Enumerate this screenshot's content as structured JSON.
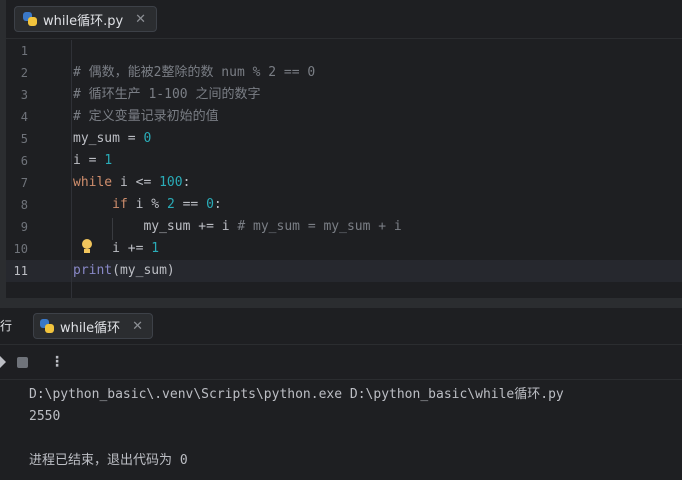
{
  "editor": {
    "tab": {
      "label": "while循环.py",
      "close": "✕",
      "icon": "python-file-icon"
    },
    "line_numbers": [
      "1",
      "2",
      "3",
      "4",
      "5",
      "6",
      "7",
      "8",
      "9",
      "10",
      "11"
    ],
    "current_line": "11",
    "lines": [
      {
        "indent": "",
        "tokens": []
      },
      {
        "indent": "",
        "tokens": [
          {
            "cls": "c",
            "text": "# 偶数，能被2整除的数 num % 2 == 0"
          }
        ]
      },
      {
        "indent": "",
        "tokens": [
          {
            "cls": "c",
            "text": "# 循环生产 1-100 之间的数字"
          }
        ]
      },
      {
        "indent": "",
        "tokens": [
          {
            "cls": "c",
            "text": "# 定义变量记录初始的值"
          }
        ]
      },
      {
        "indent": "",
        "tokens": [
          {
            "cls": "t",
            "text": "my_sum = "
          },
          {
            "cls": "n",
            "text": "0"
          }
        ]
      },
      {
        "indent": "",
        "tokens": [
          {
            "cls": "t",
            "text": "i = "
          },
          {
            "cls": "n",
            "text": "1"
          }
        ]
      },
      {
        "indent": "",
        "tokens": [
          {
            "cls": "k",
            "text": "while"
          },
          {
            "cls": "t",
            "text": " i <= "
          },
          {
            "cls": "n",
            "text": "100"
          },
          {
            "cls": "t",
            "text": ":"
          }
        ]
      },
      {
        "indent": "     ",
        "tokens": [
          {
            "cls": "k",
            "text": "if"
          },
          {
            "cls": "t",
            "text": " i % "
          },
          {
            "cls": "n",
            "text": "2"
          },
          {
            "cls": "t",
            "text": " == "
          },
          {
            "cls": "n",
            "text": "0"
          },
          {
            "cls": "t",
            "text": ":"
          }
        ]
      },
      {
        "indent": "         ",
        "tokens": [
          {
            "cls": "t",
            "text": "my_sum += i "
          },
          {
            "cls": "c",
            "text": "# my_sum = my_sum + i"
          }
        ]
      },
      {
        "indent": "     ",
        "tokens": [
          {
            "cls": "t",
            "text": "i += "
          },
          {
            "cls": "n",
            "text": "1"
          }
        ]
      },
      {
        "indent": "",
        "tokens": [
          {
            "cls": "f",
            "text": "print"
          },
          {
            "cls": "t",
            "text": "(my_sum)"
          }
        ]
      }
    ]
  },
  "run": {
    "title": "行",
    "tab": {
      "label": "while循环",
      "close": "✕",
      "icon": "python-file-icon"
    },
    "toolbar": {
      "more": "⋮"
    },
    "output": [
      "D:\\python_basic\\.venv\\Scripts\\python.exe D:\\python_basic\\while循环.py",
      "2550",
      "",
      "进程已结束，退出代码为 0"
    ]
  }
}
